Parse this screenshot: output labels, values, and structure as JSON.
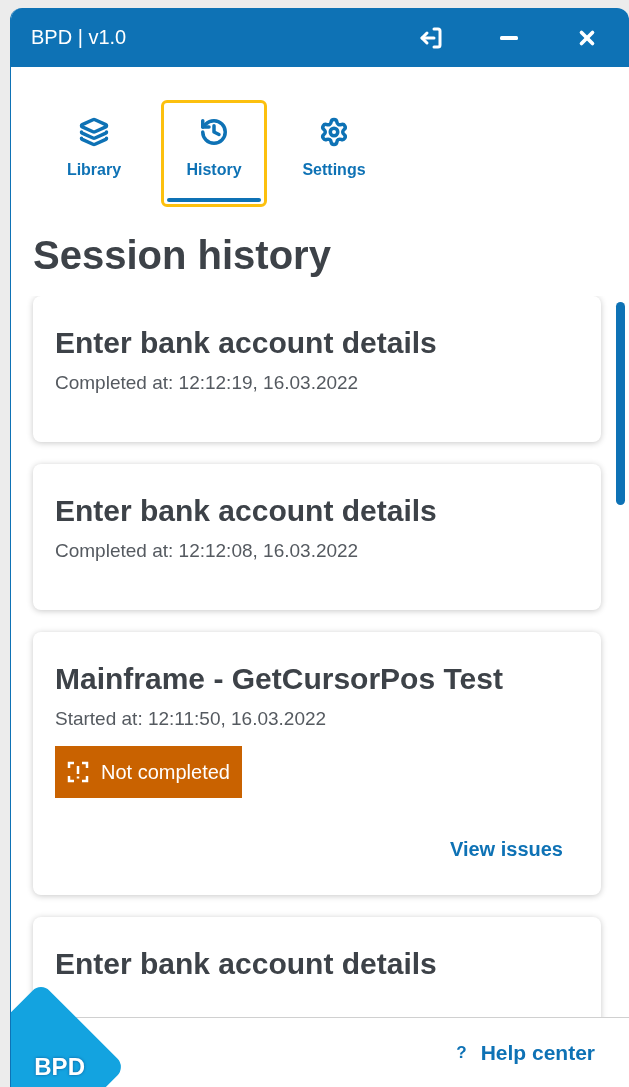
{
  "window": {
    "title": "BPD | v1.0"
  },
  "tabs": [
    {
      "label": "Library",
      "selected": false
    },
    {
      "label": "History",
      "selected": true
    },
    {
      "label": "Settings",
      "selected": false
    }
  ],
  "heading": "Session history",
  "sessions": [
    {
      "title": "Enter bank account details",
      "subtitle": "Completed at: 12:12:19, 16.03.2022"
    },
    {
      "title": "Enter bank account details",
      "subtitle": "Completed at: 12:12:08, 16.03.2022"
    },
    {
      "title": "Mainframe - GetCursorPos Test",
      "subtitle": "Started at: 12:11:50, 16.03.2022",
      "badge": "Not completed",
      "link": "View issues"
    },
    {
      "title": "Enter bank account details"
    }
  ],
  "footer": {
    "logo": "BPD",
    "help_glyph": "?",
    "help": "Help center"
  }
}
